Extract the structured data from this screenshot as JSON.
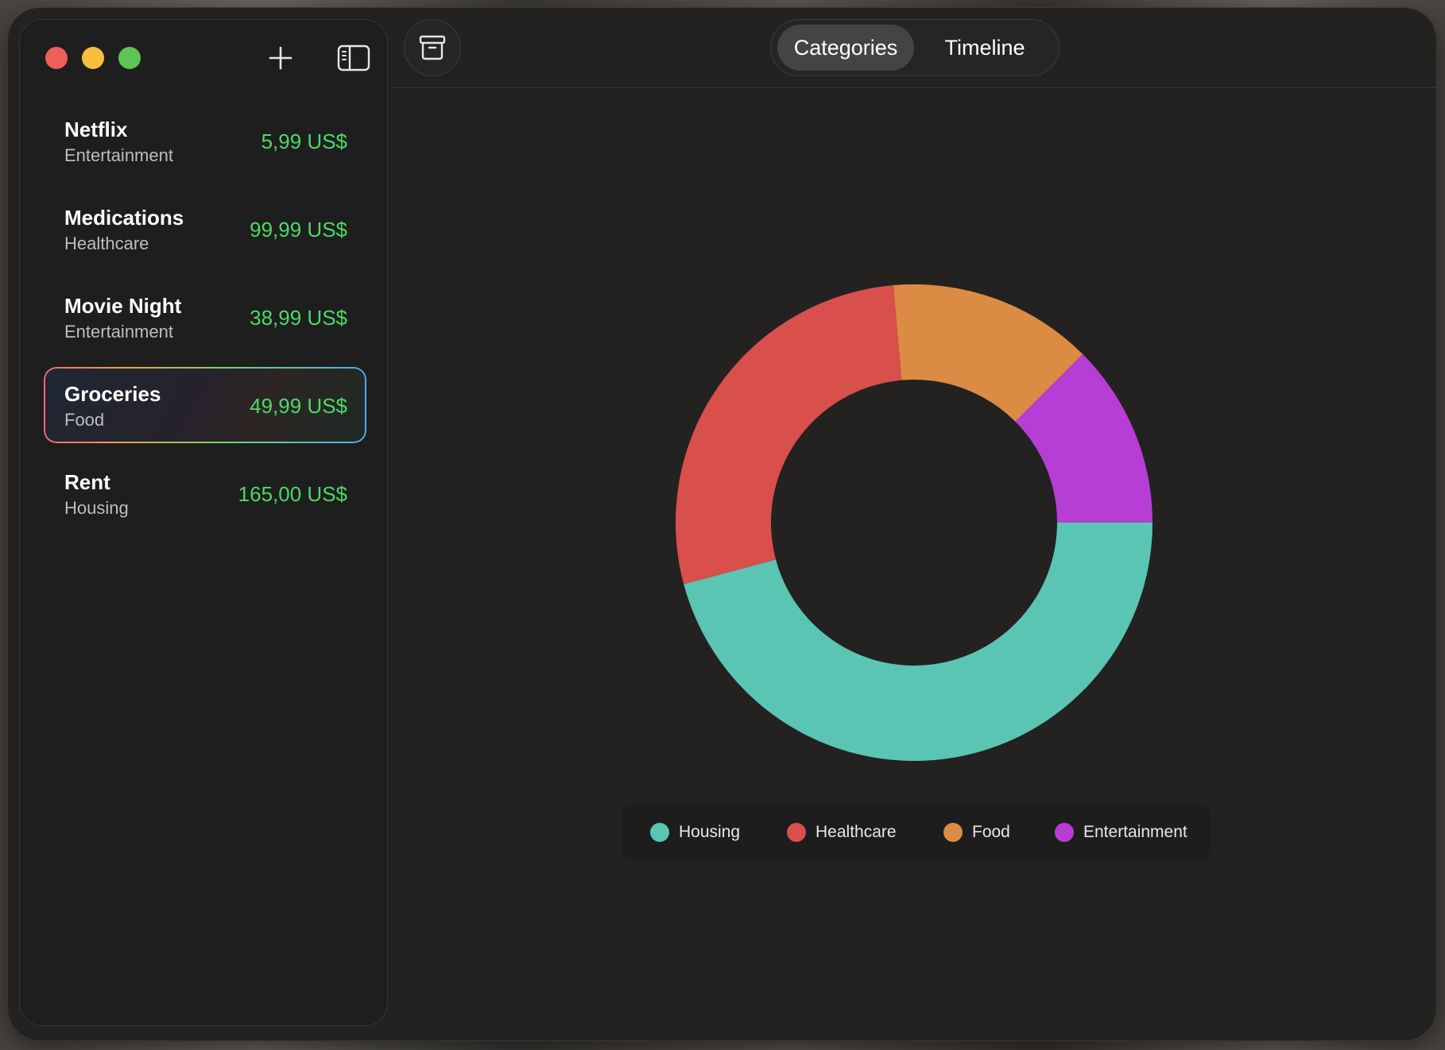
{
  "sidebar": {
    "items": [
      {
        "name": "Netflix",
        "category": "Entertainment",
        "amount": "5,99 US$"
      },
      {
        "name": "Medications",
        "category": "Healthcare",
        "amount": "99,99 US$"
      },
      {
        "name": "Movie Night",
        "category": "Entertainment",
        "amount": "38,99 US$"
      },
      {
        "name": "Groceries",
        "category": "Food",
        "amount": "49,99 US$",
        "selected": true
      },
      {
        "name": "Rent",
        "category": "Housing",
        "amount": "165,00 US$"
      }
    ]
  },
  "toolbar": {
    "icons": [
      "plus-icon",
      "sidebar-icon",
      "archive-icon"
    ],
    "segments": {
      "categories": "Categories",
      "timeline": "Timeline"
    },
    "selected_segment": "Categories"
  },
  "colors": {
    "amount": "#4cd964",
    "Housing": "#5bc5b4",
    "Healthcare": "#d84f4b",
    "Food": "#dc8b45",
    "Entertainment": "#b73ed4"
  },
  "chart_data": {
    "type": "pie",
    "donut": true,
    "legend_position": "bottom",
    "series": [
      {
        "name": "Housing",
        "value": 165.0,
        "color": "#5bc5b4"
      },
      {
        "name": "Healthcare",
        "value": 99.99,
        "color": "#d84f4b"
      },
      {
        "name": "Food",
        "value": 49.99,
        "color": "#dc8b45"
      },
      {
        "name": "Entertainment",
        "value": 44.98,
        "color": "#b73ed4"
      }
    ]
  }
}
